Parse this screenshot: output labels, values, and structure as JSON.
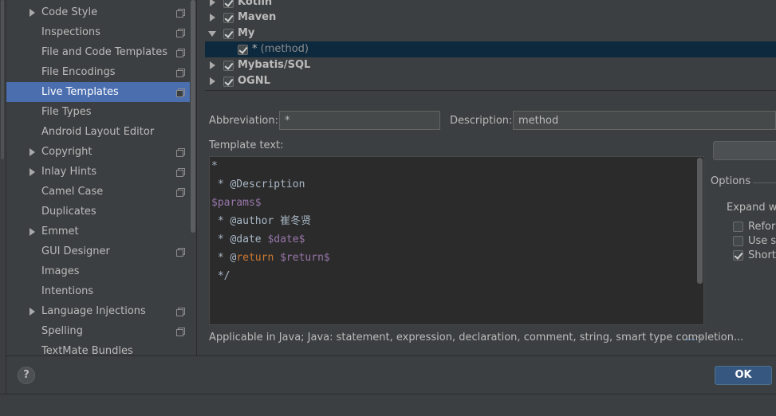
{
  "colors": {
    "background": "#3c3f41",
    "selection": "#4b6eaf",
    "editor_bg": "#2b2b2b",
    "variable": "#9876aa",
    "keyword": "#cc7832",
    "ok_button": "#365880"
  },
  "settings_tree": [
    {
      "label": "Code Style",
      "has_arrow": true,
      "has_copy": true
    },
    {
      "label": "Inspections",
      "has_arrow": false,
      "has_copy": true
    },
    {
      "label": "File and Code Templates",
      "has_arrow": false,
      "has_copy": true
    },
    {
      "label": "File Encodings",
      "has_arrow": false,
      "has_copy": true
    },
    {
      "label": "Live Templates",
      "has_arrow": false,
      "has_copy": true,
      "selected": true
    },
    {
      "label": "File Types",
      "has_arrow": false,
      "has_copy": false
    },
    {
      "label": "Android Layout Editor",
      "has_arrow": false,
      "has_copy": false
    },
    {
      "label": "Copyright",
      "has_arrow": true,
      "has_copy": true
    },
    {
      "label": "Inlay Hints",
      "has_arrow": true,
      "has_copy": true
    },
    {
      "label": "Camel Case",
      "has_arrow": false,
      "has_copy": true
    },
    {
      "label": "Duplicates",
      "has_arrow": false,
      "has_copy": false
    },
    {
      "label": "Emmet",
      "has_arrow": true,
      "has_copy": false
    },
    {
      "label": "GUI Designer",
      "has_arrow": false,
      "has_copy": true
    },
    {
      "label": "Images",
      "has_arrow": false,
      "has_copy": false
    },
    {
      "label": "Intentions",
      "has_arrow": false,
      "has_copy": false
    },
    {
      "label": "Language Injections",
      "has_arrow": true,
      "has_copy": true
    },
    {
      "label": "Spelling",
      "has_arrow": false,
      "has_copy": true
    },
    {
      "label": "TextMate Bundles",
      "has_arrow": false,
      "has_copy": false
    }
  ],
  "template_groups": {
    "kotlin": "Kotlin",
    "maven": "Maven",
    "my": "My",
    "my_template_abbr": "*",
    "my_template_desc": "(method)",
    "mybatis": "Mybatis/SQL",
    "ognl": "OGNL"
  },
  "form": {
    "abbreviation_label": "Abbreviation:",
    "abbreviation_value": "*",
    "description_label": "Description:",
    "description_value": "method",
    "template_text_label": "Template text:"
  },
  "template_code": {
    "line1": "*",
    "line2": " * @Description",
    "line3_var": "$params$",
    "line4": " * @author 崔冬贤",
    "line5_prefix": " * @date ",
    "line5_var": "$date$",
    "line6_prefix": " * @",
    "line6_kw": "return",
    "line6_space": " ",
    "line6_var": "$return$",
    "line7": " */"
  },
  "applicable": {
    "text": "Applicable in Java; Java: statement, expression, declaration, comment, string, smart type completion...",
    "change_link": "..."
  },
  "options": {
    "title": "Options",
    "expand_label": "Expand wit",
    "reformat": "Reforr",
    "reformat_checked": false,
    "use_static": "Use st",
    "use_static_checked": false,
    "shorten": "Shorte",
    "shorten_checked": true
  },
  "buttons": {
    "help": "?",
    "ok": "OK"
  }
}
